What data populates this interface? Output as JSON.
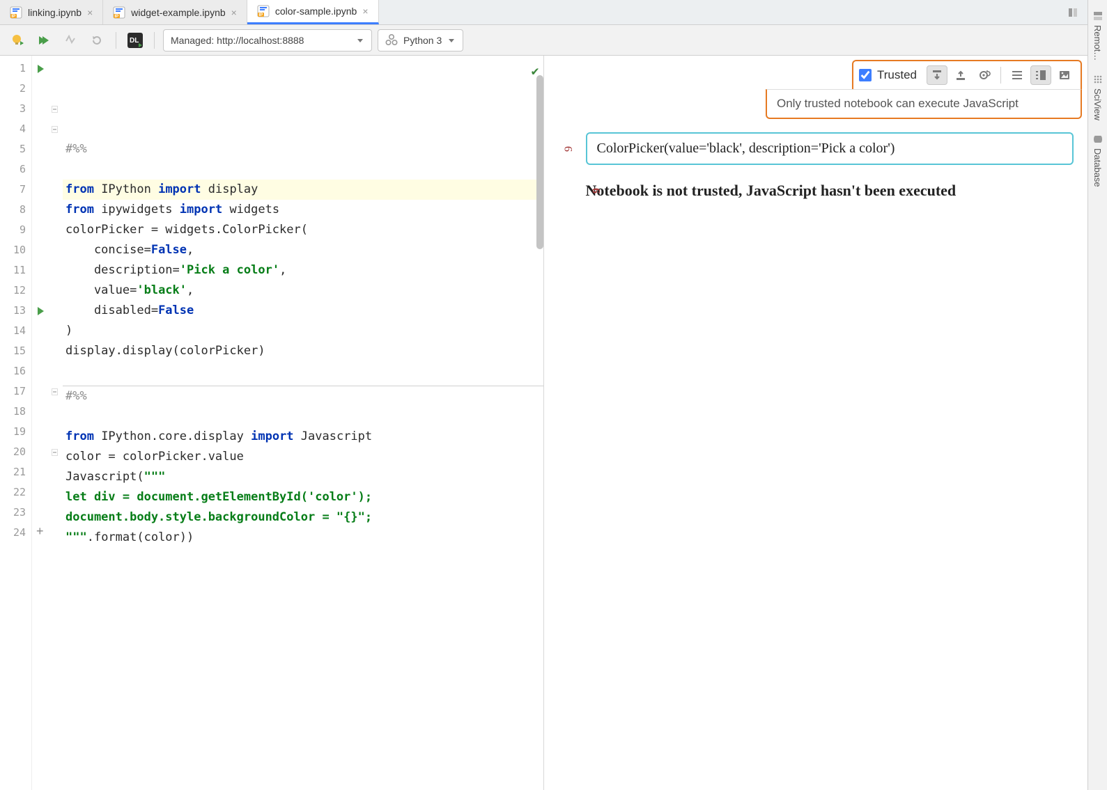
{
  "tabs": [
    {
      "label": "linking.ipynb",
      "active": false
    },
    {
      "label": "widget-example.ipynb",
      "active": false
    },
    {
      "label": "color-sample.ipynb",
      "active": true
    }
  ],
  "toolbar": {
    "server_dropdown": "Managed: http://localhost:8888",
    "kernel_dropdown": "Python 3"
  },
  "editor": {
    "lines": [
      {
        "n": 1,
        "run": true,
        "text": "#%%",
        "type": "comment"
      },
      {
        "n": 2,
        "text": ""
      },
      {
        "n": 3,
        "hl": true,
        "fold": true,
        "html": "<span class='kw'>from</span> IPython <span class='kw'>import</span> display"
      },
      {
        "n": 4,
        "fold": true,
        "html": "<span class='kw'>from</span> ipywidgets <span class='kw'>import</span> widgets"
      },
      {
        "n": 5,
        "html": "colorPicker = widgets.ColorPicker("
      },
      {
        "n": 6,
        "html": "    concise=<span class='bool'>False</span>,"
      },
      {
        "n": 7,
        "html": "    description=<span class='str'>'Pick a color'</span>,"
      },
      {
        "n": 8,
        "html": "    value=<span class='str'>'black'</span>,"
      },
      {
        "n": 9,
        "html": "    disabled=<span class='bool'>False</span>"
      },
      {
        "n": 10,
        "html": ")"
      },
      {
        "n": 11,
        "html": "display.display(colorPicker)"
      },
      {
        "n": 12,
        "text": "",
        "hr_after": true
      },
      {
        "n": 13,
        "run": true,
        "text": "#%%",
        "type": "comment"
      },
      {
        "n": 14,
        "text": ""
      },
      {
        "n": 15,
        "html": "<span class='kw'>from</span> IPython.core.display <span class='kw'>import</span> Javascript"
      },
      {
        "n": 16,
        "html": "color = colorPicker.value"
      },
      {
        "n": 17,
        "fold": true,
        "html": "Javascript(<span class='str'>\"\"\"</span>"
      },
      {
        "n": 18,
        "html": "<span class='str'>let div = document.getElementById('color');</span>"
      },
      {
        "n": 19,
        "html": "<span class='str'>document.body.style.backgroundColor = \"{}\";</span>"
      },
      {
        "n": 20,
        "fold": true,
        "html": "<span class='str'>\"\"\"</span>.format(color))"
      },
      {
        "n": 21,
        "text": ""
      },
      {
        "n": 22,
        "text": ""
      },
      {
        "n": 23,
        "text": ""
      },
      {
        "n": 24,
        "text": "",
        "plus": true
      }
    ]
  },
  "preview": {
    "trusted_label": "Trusted",
    "trusted_checked": true,
    "tooltip": "Only trusted notebook can execute JavaScript",
    "output_text": "ColorPicker(value='black', description='Pick a color')",
    "output_marker": "9",
    "warn_marker": "9",
    "warning": "Notebook is not trusted, JavaScript hasn't been executed"
  },
  "rightbar": {
    "items": [
      "Remot…",
      "SciView",
      "Database"
    ]
  }
}
